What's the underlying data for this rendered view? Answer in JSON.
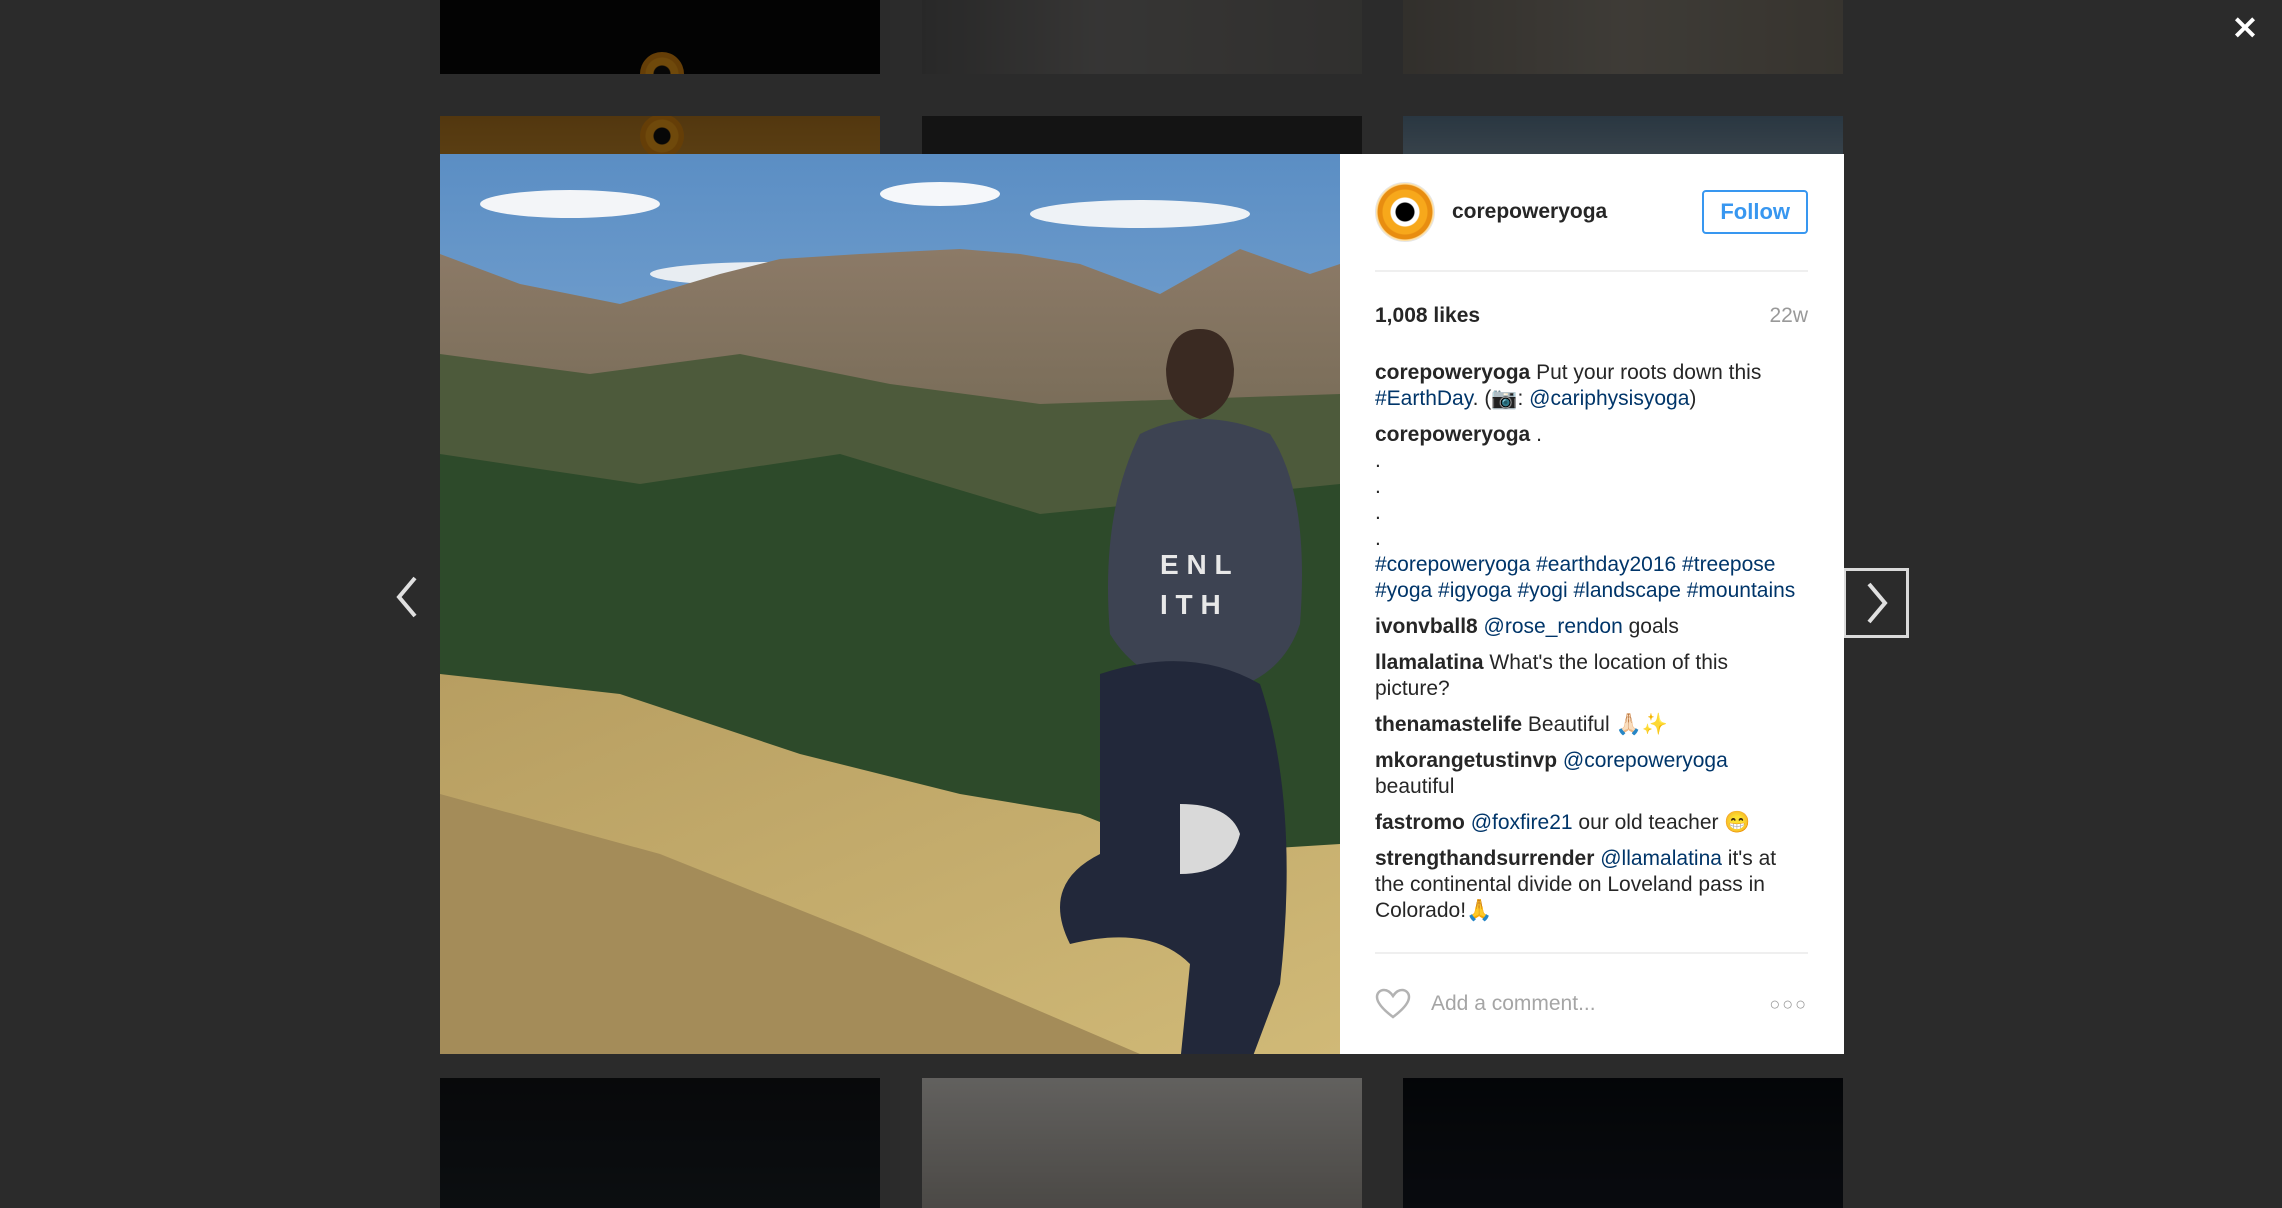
{
  "post": {
    "username": "corepoweryoga",
    "follow_label": "Follow",
    "likes": "1,008 likes",
    "age": "22w"
  },
  "comments": [
    {
      "user": "corepoweryoga",
      "parts": [
        "Put your roots down this ",
        "#EarthDay",
        ". (📷: ",
        "@cariphysisyoga",
        ")"
      ]
    },
    {
      "user": "corepoweryoga",
      "text": ".",
      "dots": ".\n.\n.\n.",
      "hashtags": "#corepoweryoga #earthday2016 #treepose #yoga #igyoga #yogi #landscape #mountains"
    },
    {
      "user": "ivonvball8",
      "mention": "@rose_rendon",
      "text": " goals"
    },
    {
      "user": "llamalatina",
      "text": "What's the location of this picture?"
    },
    {
      "user": "thenamastelife",
      "text": "Beautiful 🙏🏻✨"
    },
    {
      "user": "mkorangetustinvp",
      "mention": "@corepoweryoga",
      "text": " beautiful"
    },
    {
      "user": "fastromo",
      "mention": "@foxfire21",
      "text": " our old teacher 😁"
    },
    {
      "user": "strengthandsurrender",
      "mention": "@llamalatina",
      "text": " it's at the continental divide on Loveland pass in Colorado!🙏"
    }
  ],
  "composer": {
    "placeholder": "Add a comment...",
    "more": "○○○"
  },
  "controls": {
    "close": "×"
  },
  "icons": {
    "close": "close-icon",
    "prev": "chevron-left-icon",
    "next": "chevron-right-icon",
    "like": "heart-icon",
    "more": "more-options-icon"
  },
  "colors": {
    "link": "#003569",
    "follow": "#3897f0",
    "text": "#262626"
  }
}
